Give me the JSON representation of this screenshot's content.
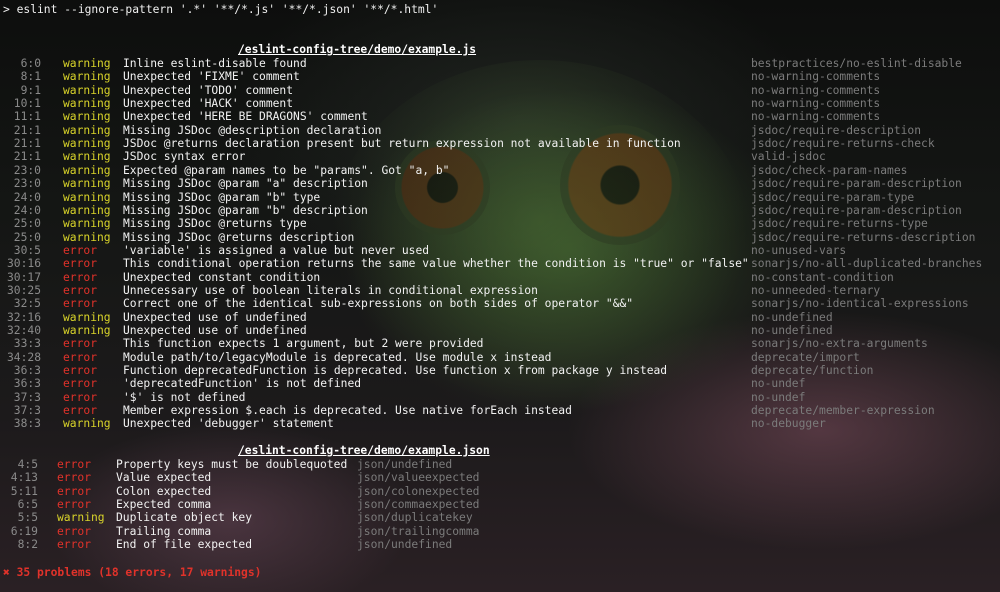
{
  "command": "> eslint --ignore-pattern '.*' '**/*.js' '**/*.json' '**/*.html'",
  "colors": {
    "warning": "#d8d32a",
    "error": "#e0322a",
    "rule": "#7b7b7b",
    "location": "#8a8a8a"
  },
  "files": [
    {
      "path": "/eslint-config-tree/demo/example.js",
      "messages": [
        {
          "loc": "6:0",
          "severity": "warning",
          "text": "Inline eslint-disable found",
          "rule": "bestpractices/no-eslint-disable"
        },
        {
          "loc": "8:1",
          "severity": "warning",
          "text": "Unexpected 'FIXME' comment",
          "rule": "no-warning-comments"
        },
        {
          "loc": "9:1",
          "severity": "warning",
          "text": "Unexpected 'TODO' comment",
          "rule": "no-warning-comments"
        },
        {
          "loc": "10:1",
          "severity": "warning",
          "text": "Unexpected 'HACK' comment",
          "rule": "no-warning-comments"
        },
        {
          "loc": "11:1",
          "severity": "warning",
          "text": "Unexpected 'HERE BE DRAGONS' comment",
          "rule": "no-warning-comments"
        },
        {
          "loc": "21:1",
          "severity": "warning",
          "text": "Missing JSDoc @description declaration",
          "rule": "jsdoc/require-description"
        },
        {
          "loc": "21:1",
          "severity": "warning",
          "text": "JSDoc @returns declaration present but return expression not available in function",
          "rule": "jsdoc/require-returns-check"
        },
        {
          "loc": "21:1",
          "severity": "warning",
          "text": "JSDoc syntax error",
          "rule": "valid-jsdoc"
        },
        {
          "loc": "23:0",
          "severity": "warning",
          "text": "Expected @param names to be \"params\". Got \"a, b\"",
          "rule": "jsdoc/check-param-names"
        },
        {
          "loc": "23:0",
          "severity": "warning",
          "text": "Missing JSDoc @param \"a\" description",
          "rule": "jsdoc/require-param-description"
        },
        {
          "loc": "24:0",
          "severity": "warning",
          "text": "Missing JSDoc @param \"b\" type",
          "rule": "jsdoc/require-param-type"
        },
        {
          "loc": "24:0",
          "severity": "warning",
          "text": "Missing JSDoc @param \"b\" description",
          "rule": "jsdoc/require-param-description"
        },
        {
          "loc": "25:0",
          "severity": "warning",
          "text": "Missing JSDoc @returns type",
          "rule": "jsdoc/require-returns-type"
        },
        {
          "loc": "25:0",
          "severity": "warning",
          "text": "Missing JSDoc @returns description",
          "rule": "jsdoc/require-returns-description"
        },
        {
          "loc": "30:5",
          "severity": "error",
          "text": "'variable' is assigned a value but never used",
          "rule": "no-unused-vars"
        },
        {
          "loc": "30:16",
          "severity": "error",
          "text": "This conditional operation returns the same value whether the condition is \"true\" or \"false\"",
          "rule": "sonarjs/no-all-duplicated-branches"
        },
        {
          "loc": "30:17",
          "severity": "error",
          "text": "Unexpected constant condition",
          "rule": "no-constant-condition"
        },
        {
          "loc": "30:25",
          "severity": "error",
          "text": "Unnecessary use of boolean literals in conditional expression",
          "rule": "no-unneeded-ternary"
        },
        {
          "loc": "32:5",
          "severity": "error",
          "text": "Correct one of the identical sub-expressions on both sides of operator \"&&\"",
          "rule": "sonarjs/no-identical-expressions"
        },
        {
          "loc": "32:16",
          "severity": "warning",
          "text": "Unexpected use of undefined",
          "rule": "no-undefined"
        },
        {
          "loc": "32:40",
          "severity": "warning",
          "text": "Unexpected use of undefined",
          "rule": "no-undefined"
        },
        {
          "loc": "33:3",
          "severity": "error",
          "text": "This function expects 1 argument, but 2 were provided",
          "rule": "sonarjs/no-extra-arguments"
        },
        {
          "loc": "34:28",
          "severity": "error",
          "text": "Module path/to/legacyModule is deprecated. Use module x instead",
          "rule": "deprecate/import"
        },
        {
          "loc": "36:3",
          "severity": "error",
          "text": "Function deprecatedFunction is deprecated. Use function x from package y instead",
          "rule": "deprecate/function"
        },
        {
          "loc": "36:3",
          "severity": "error",
          "text": "'deprecatedFunction' is not defined",
          "rule": "no-undef"
        },
        {
          "loc": "37:3",
          "severity": "error",
          "text": "'$' is not defined",
          "rule": "no-undef"
        },
        {
          "loc": "37:3",
          "severity": "error",
          "text": "Member expression $.each is deprecated. Use native forEach instead",
          "rule": "deprecate/member-expression"
        },
        {
          "loc": "38:3",
          "severity": "warning",
          "text": "Unexpected 'debugger' statement",
          "rule": "no-debugger"
        }
      ]
    },
    {
      "path": "/eslint-config-tree/demo/example.json",
      "messages": [
        {
          "loc": "4:5",
          "severity": "error",
          "text": "Property keys must be doublequoted",
          "rule": "json/undefined"
        },
        {
          "loc": "4:13",
          "severity": "error",
          "text": "Value expected",
          "rule": "json/valueexpected"
        },
        {
          "loc": "5:11",
          "severity": "error",
          "text": "Colon expected",
          "rule": "json/colonexpected"
        },
        {
          "loc": "6:5",
          "severity": "error",
          "text": "Expected comma",
          "rule": "json/commaexpected"
        },
        {
          "loc": "5:5",
          "severity": "warning",
          "text": "Duplicate object key",
          "rule": "json/duplicatekey"
        },
        {
          "loc": "6:19",
          "severity": "error",
          "text": "Trailing comma",
          "rule": "json/trailingcomma"
        },
        {
          "loc": "8:2",
          "severity": "error",
          "text": "End of file expected",
          "rule": "json/undefined"
        }
      ]
    }
  ],
  "summary": "✖ 35 problems (18 errors, 17 warnings)"
}
